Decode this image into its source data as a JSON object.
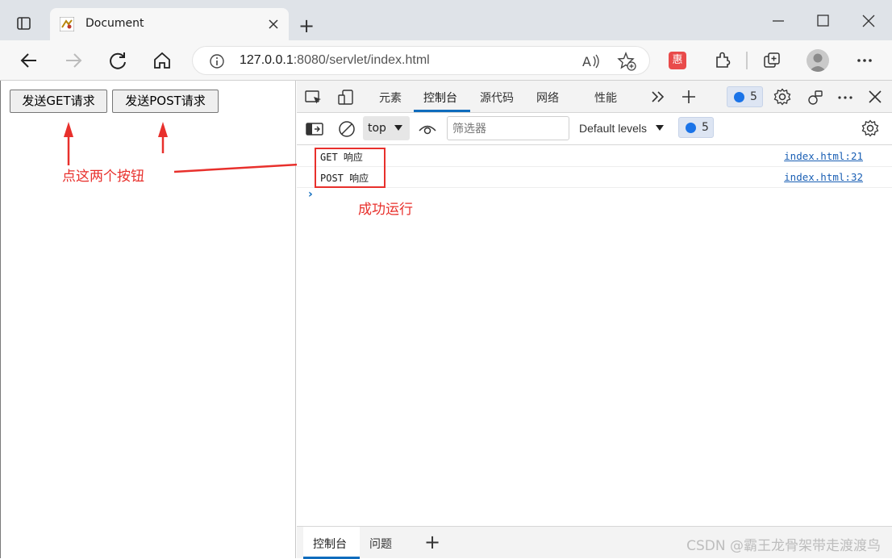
{
  "browser": {
    "tab_title": "Document",
    "new_tab_label": "+",
    "url_host": "127.0.0.1",
    "url_rest": ":8080/servlet/index.html",
    "extension_badge": "惠"
  },
  "page": {
    "get_button": "发送GET请求",
    "post_button": "发送POST请求",
    "annotation_click": "点这两个按钮",
    "annotation_success": "成功运行"
  },
  "devtools": {
    "tabs": [
      "元素",
      "控制台",
      "源代码",
      "网络",
      "性能"
    ],
    "active_tab": "控制台",
    "issues_count": "5",
    "context": "top",
    "filter_placeholder": "筛选器",
    "levels": "Default levels",
    "messages_count": "5",
    "logs": [
      {
        "message": "GET 响应",
        "source": "index.html:21"
      },
      {
        "message": "POST 响应",
        "source": "index.html:32"
      }
    ],
    "prompt": "›",
    "bottom_tabs": [
      "控制台",
      "问题"
    ],
    "bottom_add": "+"
  },
  "watermark": "CSDN @霸王龙骨架带走渡渡鸟",
  "colors": {
    "annotation_red": "#e8302c",
    "accent_blue": "#0f6cbd"
  }
}
